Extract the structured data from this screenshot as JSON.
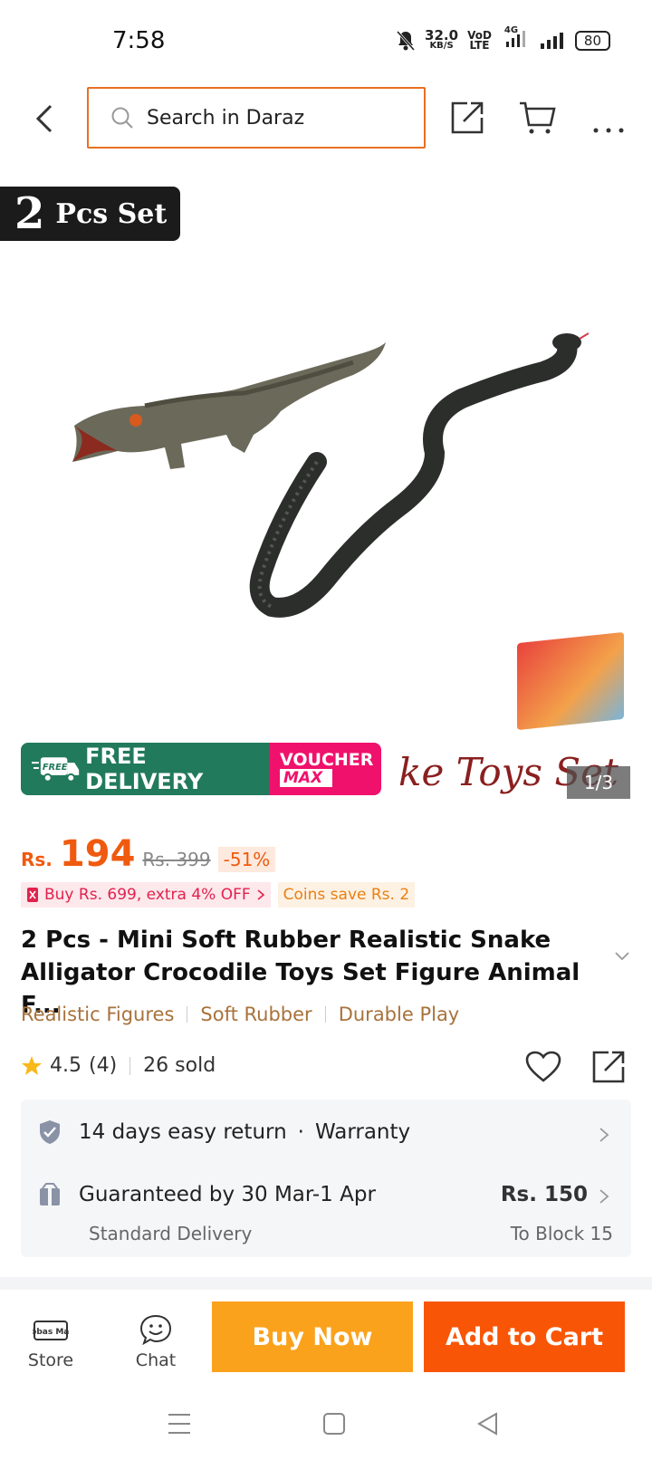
{
  "status_bar": {
    "time": "7:58",
    "speed_value": "32.0",
    "speed_unit": "KB/S",
    "volte_top": "VoD",
    "volte_bottom": "LTE",
    "network": "4G",
    "battery": "80"
  },
  "header": {
    "search_placeholder": "Search in Daraz"
  },
  "hero": {
    "badge_number": "2",
    "badge_text": "Pcs Set",
    "caption_fragment": "ke Toys Set",
    "image_counter": "1/3",
    "free_delivery": "FREE DELIVERY",
    "free_tag": "FREE",
    "voucher_line1": "VOUCHER",
    "voucher_line2": "MAX"
  },
  "price": {
    "currency": "Rs.",
    "current": "194",
    "original": "Rs. 399",
    "discount": "-51%"
  },
  "promos": {
    "bundle": "Buy Rs. 699, extra 4% OFF",
    "coins": "Coins save Rs. 2"
  },
  "product": {
    "title": "2 Pcs - Mini Soft Rubber Realistic Snake Alligator Crocodile Toys Set Figure Animal F..."
  },
  "tags": [
    "Realistic Figures",
    "Soft Rubber",
    "Durable Play"
  ],
  "rating": {
    "score": "4.5",
    "count": "(4)",
    "sold": "26 sold"
  },
  "service": {
    "return": "14 days easy return",
    "warranty": "Warranty",
    "guarantee": "Guaranteed by 30 Mar-1 Apr",
    "delivery_type": "Standard Delivery",
    "fee": "Rs. 150",
    "destination": "To Block 15"
  },
  "bottom_bar": {
    "store": "Store",
    "store_logo": "Abbas Mart",
    "chat": "Chat",
    "buy_now": "Buy Now",
    "add_to_cart": "Add to Cart"
  },
  "colors": {
    "accent_orange": "#f85606",
    "buy_yellow": "#fba21c",
    "free_delivery_green": "#227a5c",
    "voucher_pink": "#f0116c",
    "tag_brown": "#a8723b"
  }
}
